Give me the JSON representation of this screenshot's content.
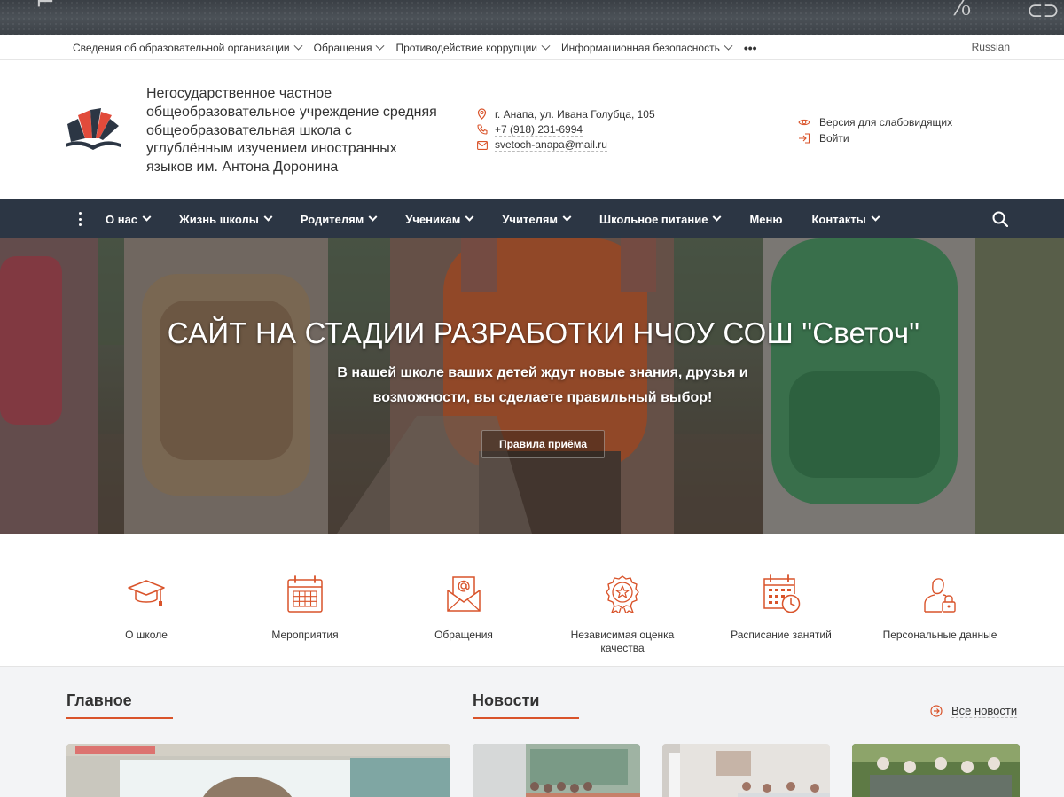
{
  "top_menu": {
    "items": [
      {
        "label": "Сведения об образовательной организации"
      },
      {
        "label": "Обращения"
      },
      {
        "label": "Противодействие коррупции"
      },
      {
        "label": "Информационная безопасность"
      }
    ],
    "more_icon": "more-horizontal-icon",
    "language": "Russian"
  },
  "header": {
    "org_name": "Негосударственное частное общеобразовательное учреждение средняя общеобразовательная школа с углублённым изучением иностранных языков им. Антона Доронина",
    "address": "г. Анапа, ул. Ивана Голубца, 105",
    "phone": "+7 (918) 231-6994",
    "email": "svetoch-anapa@mail.ru",
    "accessibility_label": "Версия для слабовидящих",
    "login_label": "Войти"
  },
  "nav": {
    "items": [
      {
        "label": "О нас",
        "dropdown": true
      },
      {
        "label": "Жизнь школы",
        "dropdown": true
      },
      {
        "label": "Родителям",
        "dropdown": true
      },
      {
        "label": "Ученикам",
        "dropdown": true
      },
      {
        "label": "Учителям",
        "dropdown": true
      },
      {
        "label": "Школьное питание",
        "dropdown": true
      },
      {
        "label": "Меню",
        "dropdown": false
      },
      {
        "label": "Контакты",
        "dropdown": true
      }
    ]
  },
  "hero": {
    "title": "САЙТ НА СТАДИИ РАЗРАБОТКИ НЧОУ СОШ \"Светоч\"",
    "subtitle": "В нашей школе ваших детей ждут новые знания, друзья и возможности, вы сделаете правильный выбор!",
    "button_label": "Правила приёма"
  },
  "quick_links": [
    {
      "label": "О школе",
      "icon": "graduation-cap-icon"
    },
    {
      "label": "Мероприятия",
      "icon": "calendar-icon"
    },
    {
      "label": "Обращения",
      "icon": "envelope-at-icon"
    },
    {
      "label": "Независимая оценка качества",
      "icon": "award-star-icon"
    },
    {
      "label": "Расписание занятий",
      "icon": "calendar-clock-icon"
    },
    {
      "label": "Персональные данные",
      "icon": "user-lock-icon"
    }
  ],
  "sections": {
    "main_title": "Главное",
    "news_title": "Новости",
    "all_news_label": "Все новости"
  },
  "colors": {
    "accent": "#d9532a",
    "nav_bg": "#2c3644",
    "section_bg": "#f3f4f6"
  }
}
